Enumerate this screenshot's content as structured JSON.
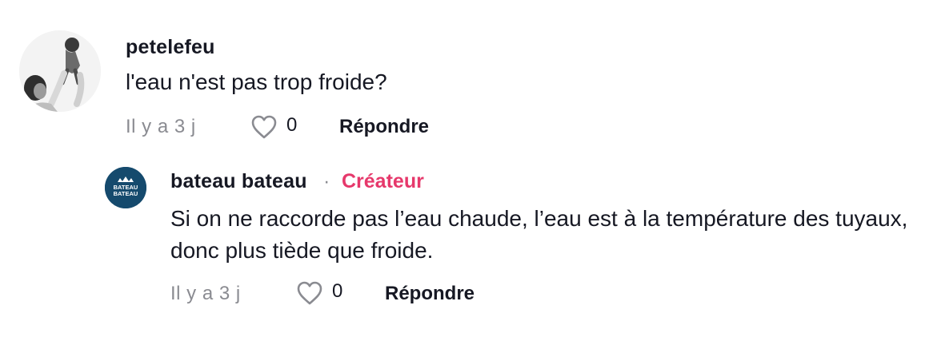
{
  "comments": [
    {
      "username": "petelefeu",
      "text": "l'eau n'est pas trop froide?",
      "timestamp": "Il y a 3 j",
      "likes": "0",
      "reply_label": "Répondre",
      "avatar_icon": "person-holding-baby-photo"
    }
  ],
  "reply": {
    "username": "bateau bateau",
    "separator": "·",
    "badge": "Créateur",
    "text": "Si on ne raccorde pas l’eau chaude, l’eau est à la température des tuyaux, donc plus tiède que froide.",
    "timestamp": "Il y a 3 j",
    "likes": "0",
    "reply_label": "Répondre",
    "avatar_logo_text": [
      "BATEAU",
      "BATEAU"
    ],
    "avatar_icon": "boat-crown-logo"
  },
  "colors": {
    "text": "#161823",
    "muted": "#8a8b91",
    "creator_badge": "#e6386b",
    "avatar_reply_bg": "#154a6d"
  }
}
